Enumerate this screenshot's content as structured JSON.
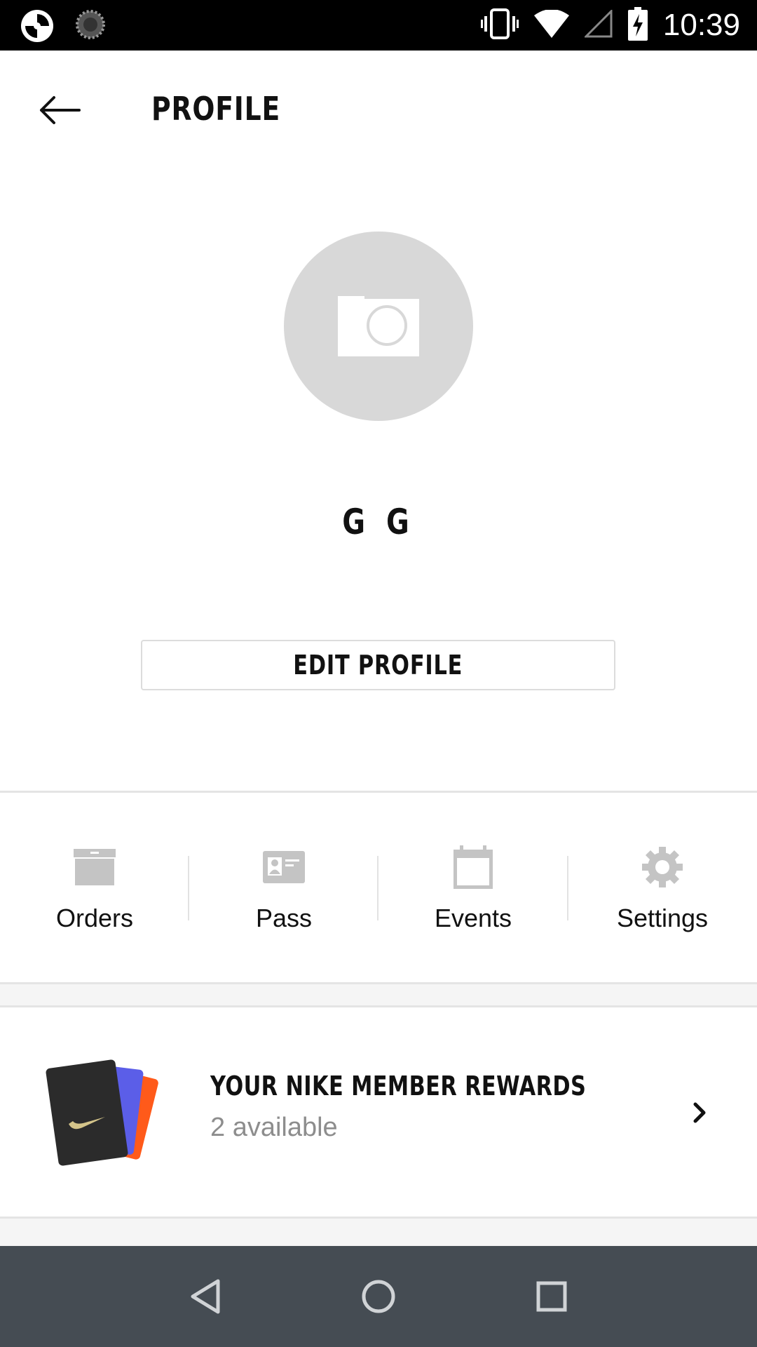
{
  "status_bar": {
    "time": "10:39",
    "icons": [
      "app-shutter-icon",
      "loading-icon",
      "vibrate-icon",
      "wifi-icon",
      "signal-icon",
      "battery-charging-icon"
    ]
  },
  "header": {
    "back_icon": "arrow-left-icon",
    "title": "PROFILE"
  },
  "profile": {
    "avatar_icon": "camera-icon",
    "name": "G G",
    "edit_button_label": "EDIT PROFILE"
  },
  "quick_links": [
    {
      "label": "Orders",
      "icon": "box-icon"
    },
    {
      "label": "Pass",
      "icon": "id-card-icon"
    },
    {
      "label": "Events",
      "icon": "calendar-icon"
    },
    {
      "label": "Settings",
      "icon": "gear-icon"
    }
  ],
  "rewards": {
    "title": "YOUR NIKE MEMBER REWARDS",
    "subtitle": "2 available",
    "icon": "reward-cards-icon"
  },
  "nav_bar": {
    "buttons": [
      "back-triangle-icon",
      "home-circle-icon",
      "recents-square-icon"
    ]
  },
  "colors": {
    "status_bar": "#000000",
    "nav_bar": "#454c53",
    "avatar_bg": "#d8d8d8",
    "icon_gray": "#c4c4c4",
    "subtitle_gray": "#8d8d8d"
  }
}
